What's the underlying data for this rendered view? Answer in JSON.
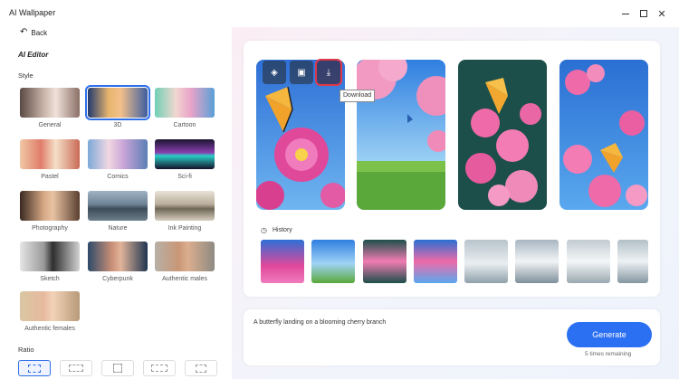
{
  "window": {
    "title": "AI Wallpaper"
  },
  "left": {
    "back_label": "Back",
    "editor_title": "AI Editor",
    "style_label": "Style",
    "ratio_label": "Ratio",
    "styles": [
      {
        "name": "General",
        "selected": false
      },
      {
        "name": "3D",
        "selected": true
      },
      {
        "name": "Cartoon",
        "selected": false
      },
      {
        "name": "Pastel",
        "selected": false
      },
      {
        "name": "Comics",
        "selected": false
      },
      {
        "name": "Sci-fi",
        "selected": false
      },
      {
        "name": "Photography",
        "selected": false
      },
      {
        "name": "Nature",
        "selected": false
      },
      {
        "name": "Ink Painting",
        "selected": false
      },
      {
        "name": "Sketch",
        "selected": false
      },
      {
        "name": "Cyberpunk",
        "selected": false
      },
      {
        "name": "Authentic males",
        "selected": false
      },
      {
        "name": "Authentic females",
        "selected": false
      }
    ]
  },
  "gallery": {
    "tooltip": "Download",
    "history_label": "History"
  },
  "prompt": {
    "text": "A butterfly landing on a blooming cherry branch",
    "generate_label": "Generate",
    "remaining": "5 times remaining"
  },
  "colors": {
    "accent": "#2b6ff2",
    "selected_border": "#2f6fea",
    "active_tool": "#e0384a"
  }
}
